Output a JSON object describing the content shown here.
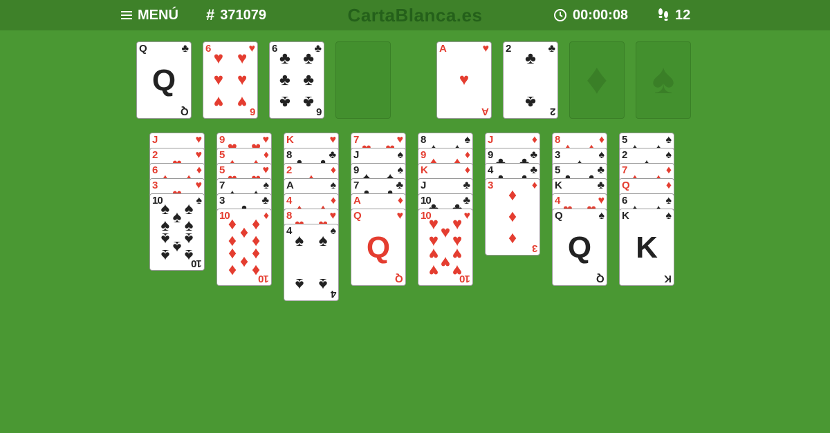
{
  "header": {
    "menu_label": "MENÚ",
    "game_number": "371079",
    "site_title": "CartaBlanca.es",
    "timer": "00:00:08",
    "moves": "12"
  },
  "free_cells": [
    {
      "rank": "Q",
      "suit": "♣",
      "color": "black"
    },
    {
      "rank": "6",
      "suit": "♥",
      "color": "red"
    },
    {
      "rank": "6",
      "suit": "♣",
      "color": "black"
    },
    null
  ],
  "foundations": [
    {
      "rank": "A",
      "suit": "♥",
      "color": "red"
    },
    {
      "rank": "2",
      "suit": "♣",
      "color": "black"
    },
    {
      "empty_suit": "♦"
    },
    {
      "empty_suit": "♠"
    }
  ],
  "tableau": [
    [
      {
        "rank": "J",
        "suit": "♥",
        "color": "red"
      },
      {
        "rank": "2",
        "suit": "♥",
        "color": "red"
      },
      {
        "rank": "6",
        "suit": "♦",
        "color": "red"
      },
      {
        "rank": "3",
        "suit": "♥",
        "color": "red"
      },
      {
        "rank": "10",
        "suit": "♠",
        "color": "black"
      }
    ],
    [
      {
        "rank": "9",
        "suit": "♥",
        "color": "red"
      },
      {
        "rank": "5",
        "suit": "♦",
        "color": "red"
      },
      {
        "rank": "5",
        "suit": "♥",
        "color": "red"
      },
      {
        "rank": "7",
        "suit": "♠",
        "color": "black"
      },
      {
        "rank": "3",
        "suit": "♣",
        "color": "black"
      },
      {
        "rank": "10",
        "suit": "♦",
        "color": "red"
      }
    ],
    [
      {
        "rank": "K",
        "suit": "♥",
        "color": "red"
      },
      {
        "rank": "8",
        "suit": "♣",
        "color": "black"
      },
      {
        "rank": "2",
        "suit": "♦",
        "color": "red"
      },
      {
        "rank": "A",
        "suit": "♠",
        "color": "black"
      },
      {
        "rank": "4",
        "suit": "♦",
        "color": "red"
      },
      {
        "rank": "8",
        "suit": "♥",
        "color": "red"
      },
      {
        "rank": "4",
        "suit": "♠",
        "color": "black"
      }
    ],
    [
      {
        "rank": "7",
        "suit": "♥",
        "color": "red"
      },
      {
        "rank": "J",
        "suit": "♠",
        "color": "black"
      },
      {
        "rank": "9",
        "suit": "♠",
        "color": "black"
      },
      {
        "rank": "7",
        "suit": "♣",
        "color": "black"
      },
      {
        "rank": "A",
        "suit": "♦",
        "color": "red"
      },
      {
        "rank": "Q",
        "suit": "♥",
        "color": "red"
      }
    ],
    [
      {
        "rank": "8",
        "suit": "♠",
        "color": "black"
      },
      {
        "rank": "9",
        "suit": "♦",
        "color": "red"
      },
      {
        "rank": "K",
        "suit": "♦",
        "color": "red"
      },
      {
        "rank": "J",
        "suit": "♣",
        "color": "black"
      },
      {
        "rank": "10",
        "suit": "♣",
        "color": "black"
      },
      {
        "rank": "10",
        "suit": "♥",
        "color": "red"
      }
    ],
    [
      {
        "rank": "J",
        "suit": "♦",
        "color": "red"
      },
      {
        "rank": "9",
        "suit": "♣",
        "color": "black"
      },
      {
        "rank": "4",
        "suit": "♣",
        "color": "black"
      },
      {
        "rank": "3",
        "suit": "♦",
        "color": "red"
      }
    ],
    [
      {
        "rank": "8",
        "suit": "♦",
        "color": "red"
      },
      {
        "rank": "3",
        "suit": "♠",
        "color": "black"
      },
      {
        "rank": "5",
        "suit": "♣",
        "color": "black"
      },
      {
        "rank": "K",
        "suit": "♣",
        "color": "black"
      },
      {
        "rank": "4",
        "suit": "♥",
        "color": "red"
      },
      {
        "rank": "Q",
        "suit": "♠",
        "color": "black"
      }
    ],
    [
      {
        "rank": "5",
        "suit": "♠",
        "color": "black"
      },
      {
        "rank": "2",
        "suit": "♠",
        "color": "black"
      },
      {
        "rank": "7",
        "suit": "♦",
        "color": "red"
      },
      {
        "rank": "Q",
        "suit": "♦",
        "color": "red"
      },
      {
        "rank": "6",
        "suit": "♠",
        "color": "black"
      },
      {
        "rank": "K",
        "suit": "♠",
        "color": "black"
      }
    ]
  ],
  "colors": {
    "felt": "#4a9833",
    "header": "#3e8129",
    "red_suit": "#e43d30",
    "black_suit": "#222222"
  },
  "icons": {
    "menu": "hamburger-icon",
    "game": "hash-icon",
    "timer": "clock-icon",
    "moves": "footsteps-icon"
  }
}
